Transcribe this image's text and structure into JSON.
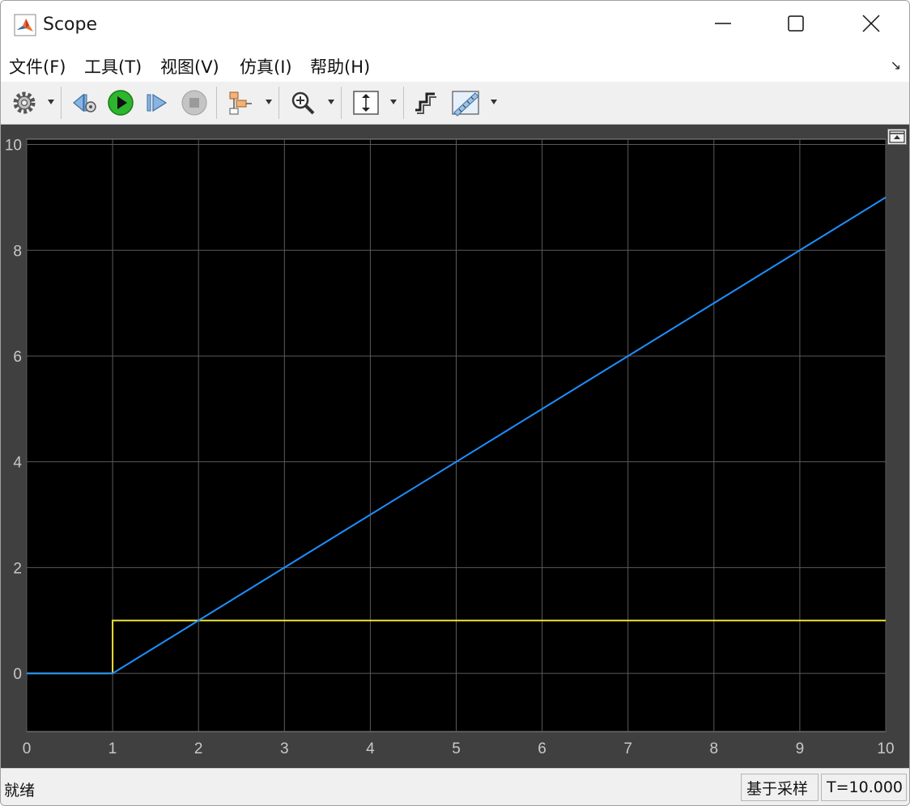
{
  "window": {
    "title": "Scope",
    "controls": [
      "minimize-icon",
      "maximize-icon",
      "close-icon"
    ]
  },
  "menu": {
    "items": [
      {
        "label": "文件(F)"
      },
      {
        "label": "工具(T)"
      },
      {
        "label": "视图(V)"
      },
      {
        "label": "仿真(I)"
      },
      {
        "label": "帮助(H)"
      }
    ],
    "dock_icon": "↘"
  },
  "toolbar": {
    "icons": [
      "settings-gear-icon",
      "step-back-icon",
      "run-icon",
      "step-forward-icon",
      "stop-icon",
      "triggers-icon",
      "zoom-in-icon",
      "scale-axes-icon",
      "signal-select-icon",
      "measurements-icon"
    ]
  },
  "colors": {
    "plot_bg": "#000000",
    "panel_bg": "#404040",
    "grid": "#5a5a5a",
    "axis_text": "#c8c8c8",
    "series_ramp": "#1e90ff",
    "series_step": "#f0e040",
    "run_green": "#2db52d"
  },
  "chart_data": {
    "type": "line",
    "title": "",
    "xlabel": "",
    "ylabel": "",
    "xlim": [
      0,
      10
    ],
    "ylim": [
      -1.1,
      10.1
    ],
    "xticks": [
      0,
      1,
      2,
      3,
      4,
      5,
      6,
      7,
      8,
      9,
      10
    ],
    "yticks": [
      0,
      2,
      4,
      6,
      8,
      10
    ],
    "grid": true,
    "series": [
      {
        "color": "#1e90ff",
        "x": [
          0,
          1,
          10
        ],
        "y": [
          0,
          0,
          9
        ]
      },
      {
        "color": "#f0e040",
        "x": [
          0,
          1,
          1,
          10
        ],
        "y": [
          0,
          0,
          1,
          1
        ]
      }
    ]
  },
  "status": {
    "text": "就绪",
    "mode": "基于采样",
    "time": "T=10.000"
  }
}
